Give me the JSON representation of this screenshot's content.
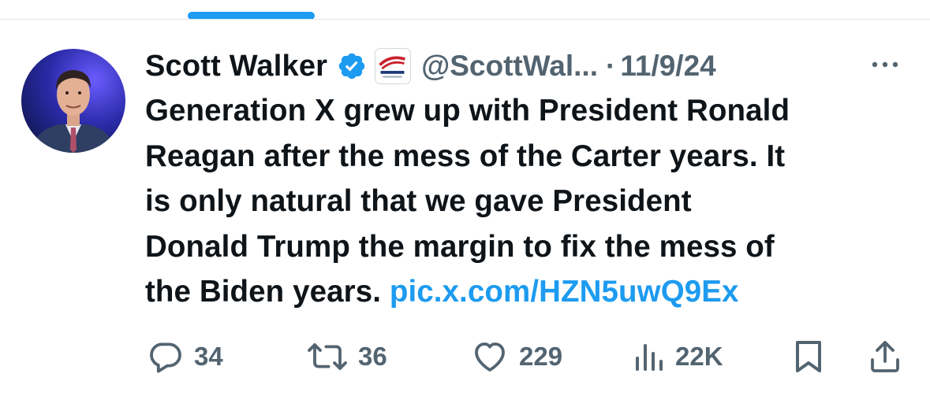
{
  "tweet": {
    "author_name": "Scott Walker",
    "handle": "@ScottWal...",
    "separator": "·",
    "date": "11/9/24",
    "text_lines": [
      "Generation X grew up with President Ronald",
      "Reagan after the mess of the Carter years. It",
      "is only natural that we gave President",
      "Donald Trump the margin to fix the mess of"
    ],
    "last_line_text": "the Biden years. ",
    "link": "pic.x.com/HZN5uwQ9Ex"
  },
  "actions": {
    "replies": "34",
    "reposts": "36",
    "likes": "229",
    "views": "22K"
  },
  "colors": {
    "accent": "#1d9bf0",
    "muted": "#536471",
    "text": "#0f1419"
  },
  "icons": [
    "verified-badge-icon",
    "affiliate-badge-icon",
    "more-icon",
    "reply-icon",
    "repost-icon",
    "like-icon",
    "views-icon",
    "bookmark-icon",
    "share-icon"
  ]
}
